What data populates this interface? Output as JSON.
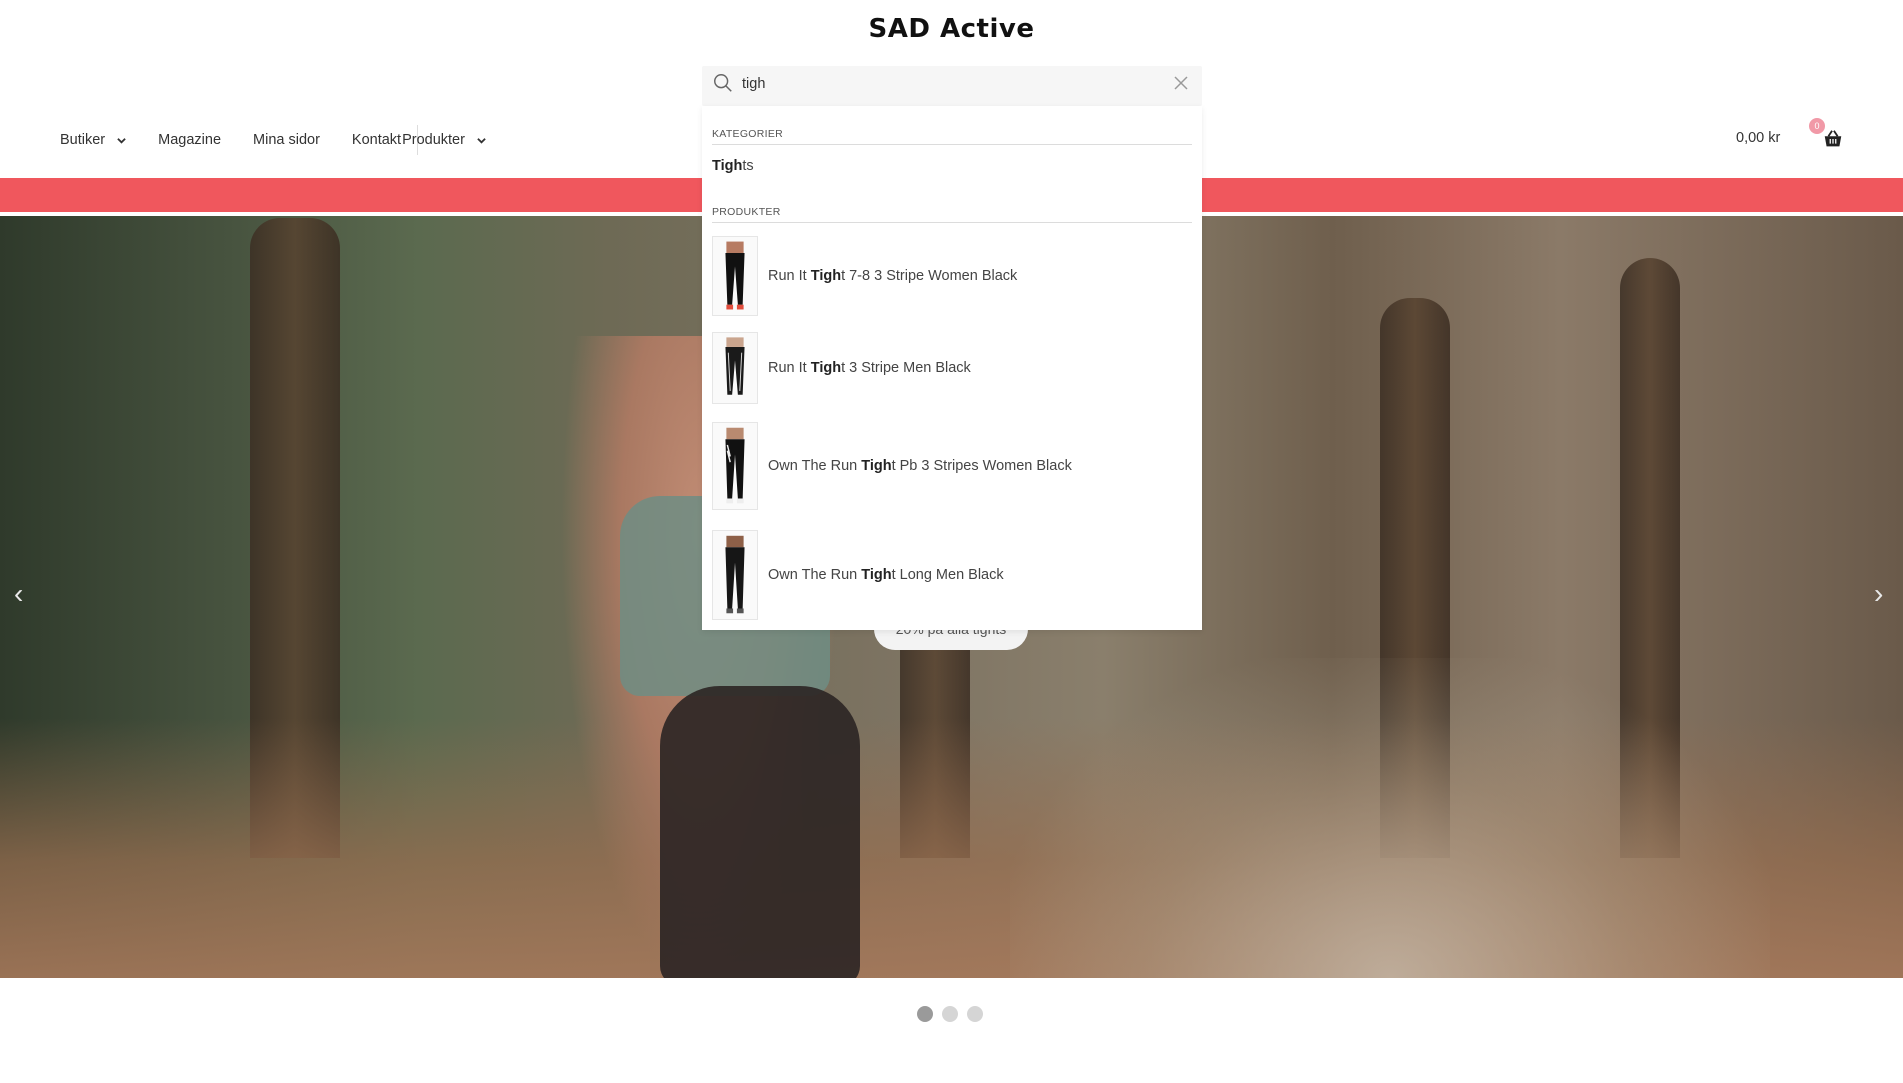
{
  "header": {
    "brand": "SAD Active",
    "nav": [
      {
        "label": "Butiker",
        "has_dropdown": true
      },
      {
        "label": "Magazine"
      },
      {
        "label": "Mina sidor"
      },
      {
        "label": "Kontakt"
      },
      {
        "label": "Produkter",
        "has_dropdown": true
      }
    ],
    "cart": {
      "amount": "0,00 kr",
      "count": "0",
      "icon": "basket-icon"
    }
  },
  "search": {
    "query": "tigh",
    "icon": "search-icon",
    "clear_icon": "close-icon",
    "results": {
      "categories_heading": "KATEGORIER",
      "categories": [
        {
          "match": "Tigh",
          "rest": "ts"
        }
      ],
      "products_heading": "PRODUKTER",
      "products": [
        {
          "pre": "Run It ",
          "match": "Tigh",
          "post": "t 7-8 3 Stripe Women Black"
        },
        {
          "pre": "Run It ",
          "match": "Tigh",
          "post": "t 3 Stripe Men Black"
        },
        {
          "pre": "Own The Run ",
          "match": "Tigh",
          "post": "t Pb 3 Stripes Women Black"
        },
        {
          "pre": "Own The Run ",
          "match": "Tigh",
          "post": "t Long Men Black"
        }
      ]
    }
  },
  "promo_bar": {
    "color": "#f0575d"
  },
  "hero": {
    "button_label": "20% på alla tights",
    "prev_arrow": "‹",
    "next_arrow": "›",
    "slides": 3,
    "active_slide": 1
  }
}
